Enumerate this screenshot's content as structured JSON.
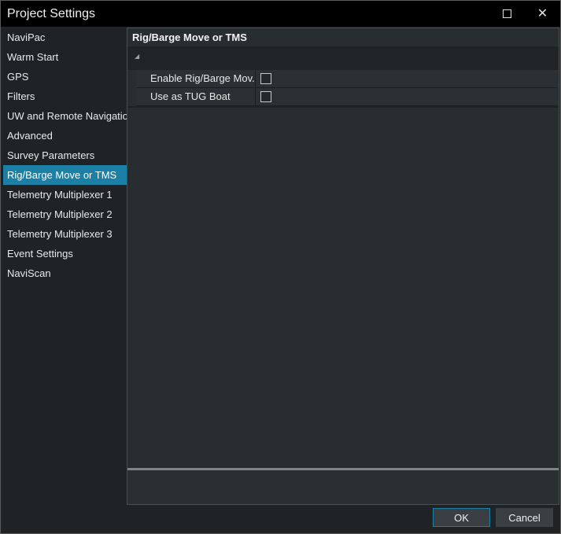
{
  "window": {
    "title": "Project Settings"
  },
  "sidebar": {
    "items": [
      {
        "label": "NaviPac",
        "active": false
      },
      {
        "label": "Warm Start",
        "active": false
      },
      {
        "label": "GPS",
        "active": false
      },
      {
        "label": "Filters",
        "active": false
      },
      {
        "label": "UW and Remote Navigation",
        "active": false
      },
      {
        "label": "Advanced",
        "active": false
      },
      {
        "label": "Survey Parameters",
        "active": false
      },
      {
        "label": "Rig/Barge Move or TMS",
        "active": true
      },
      {
        "label": "Telemetry Multiplexer 1",
        "active": false
      },
      {
        "label": "Telemetry Multiplexer 2",
        "active": false
      },
      {
        "label": "Telemetry Multiplexer 3",
        "active": false
      },
      {
        "label": "Event Settings",
        "active": false
      },
      {
        "label": "NaviScan",
        "active": false
      }
    ]
  },
  "panel": {
    "header": "Rig/Barge Move or TMS",
    "properties": [
      {
        "label": "Enable Rig/Barge Mov...",
        "checked": false
      },
      {
        "label": "Use as TUG Boat",
        "checked": false
      }
    ]
  },
  "buttons": {
    "ok": "OK",
    "cancel": "Cancel"
  },
  "colors": {
    "accent": "#1b7fa6",
    "background": "#1f2326",
    "titlebar": "#000000"
  }
}
